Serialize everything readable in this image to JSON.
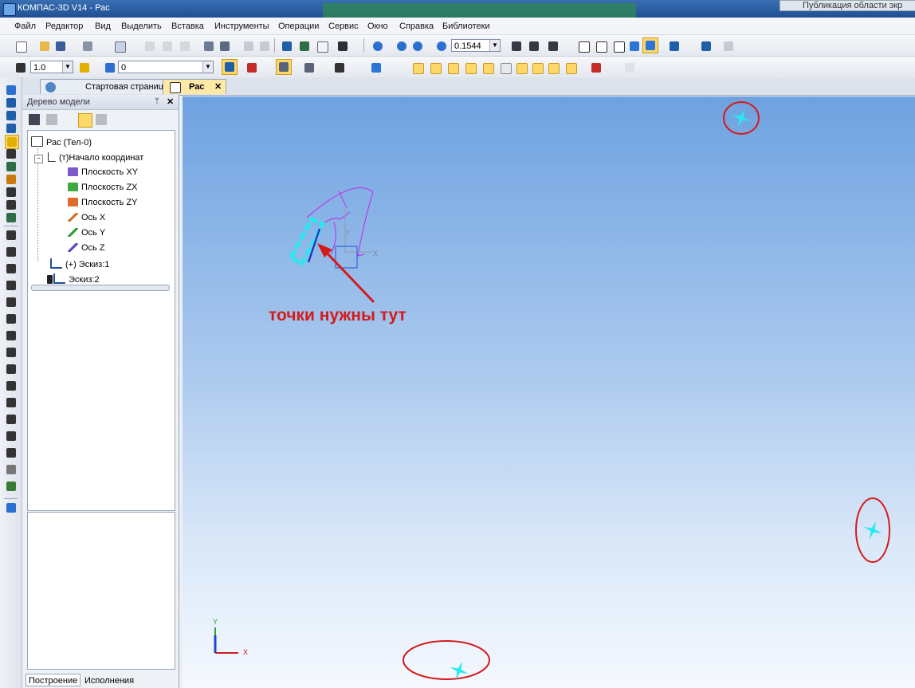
{
  "window": {
    "title": "КОМПАС-3D V14 - Рас",
    "right_tab": "Публикация области экр"
  },
  "menu": [
    "Файл",
    "Редактор",
    "Вид",
    "Выделить",
    "Вставка",
    "Инструменты",
    "Операции",
    "Сервис",
    "Окно",
    "Справка",
    "Библиотеки"
  ],
  "toolbar": {
    "zoom_value": "0.1544",
    "step_value": "1.0",
    "layer_value": "0"
  },
  "tabs": {
    "start": "Стартовая страница",
    "doc": "Рас"
  },
  "tree": {
    "panel_title": "Дерево модели",
    "nodes": {
      "root": "Рас (Тел-0)",
      "origin": "(т)Начало координат",
      "plane_xy": "Плоскость XY",
      "plane_zx": "Плоскость ZX",
      "plane_zy": "Плоскость ZY",
      "axis_x": "Ось X",
      "axis_y": "Ось Y",
      "axis_z": "Ось Z",
      "sketch1": "(+) Эскиз:1",
      "sketch2": "Эскиз:2"
    },
    "bottom_tabs": [
      "Построение",
      "Исполнения"
    ]
  },
  "viewport": {
    "annotation": "точки нужны тут",
    "axis_x_label": "X",
    "axis_y_label": "Y",
    "origin_x_label": "X",
    "origin_y_label": "Y",
    "highlight_color": "#d41b1b",
    "point_color": "#28e8f0"
  },
  "colors": {
    "title_bar": "#1f4f93",
    "viewport_top": "#6ea2e0",
    "viewport_bottom": "#f5f9fe"
  }
}
